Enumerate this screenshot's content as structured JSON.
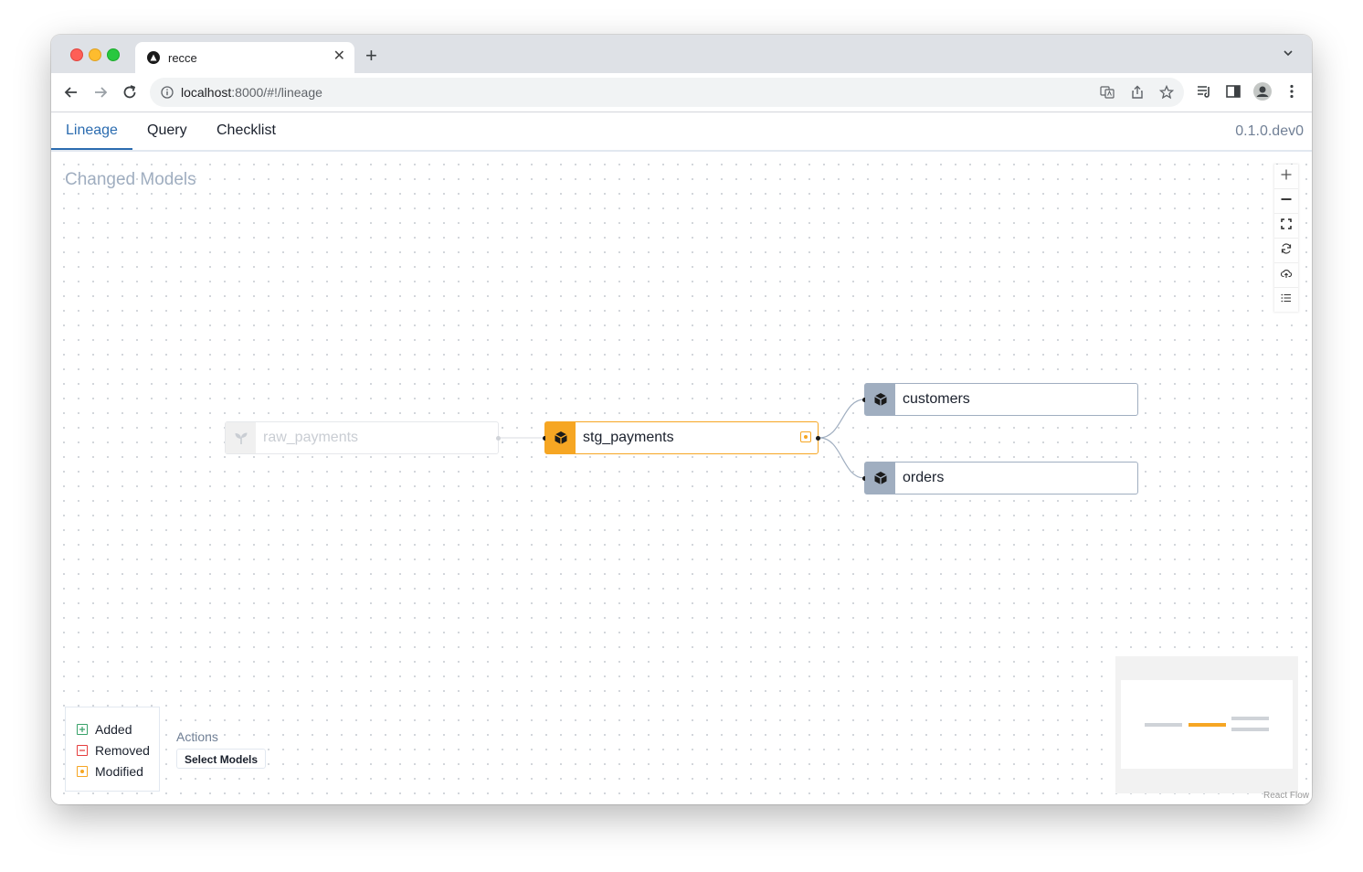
{
  "browser": {
    "tab_title": "recce",
    "tab_close": "✕",
    "new_tab": "+",
    "url_host": "localhost",
    "url_path": ":8000/#!/lineage"
  },
  "app": {
    "nav_tabs": [
      {
        "label": "Lineage",
        "active": true
      },
      {
        "label": "Query",
        "active": false
      },
      {
        "label": "Checklist",
        "active": false
      }
    ],
    "version": "0.1.0.dev0"
  },
  "canvas": {
    "title": "Changed Models",
    "nodes": [
      {
        "label": "raw_payments",
        "kind": "source",
        "state": "unchanged-dimmed"
      },
      {
        "label": "stg_payments",
        "kind": "model",
        "state": "modified"
      },
      {
        "label": "customers",
        "kind": "model",
        "state": "unchanged"
      },
      {
        "label": "orders",
        "kind": "model",
        "state": "unchanged"
      }
    ],
    "edges": [
      {
        "from": "raw_payments",
        "to": "stg_payments"
      },
      {
        "from": "stg_payments",
        "to": "customers"
      },
      {
        "from": "stg_payments",
        "to": "orders"
      }
    ],
    "controls": [
      "zoom-in-icon",
      "zoom-out-icon",
      "fit-view-icon",
      "refresh-icon",
      "cloud-upload-icon",
      "list-icon"
    ]
  },
  "legend": {
    "items": [
      {
        "label": "Added",
        "color": "#38a169"
      },
      {
        "label": "Removed",
        "color": "#e53e3e"
      },
      {
        "label": "Modified",
        "color": "#f6a623"
      }
    ]
  },
  "actions": {
    "label": "Actions",
    "select_models": "Select Models"
  },
  "minimap": {
    "attribution": "React Flow"
  },
  "colors": {
    "accent": "#2b6cb0",
    "modified": "#f6a623",
    "node_icon_bg": "#a0aec0"
  }
}
